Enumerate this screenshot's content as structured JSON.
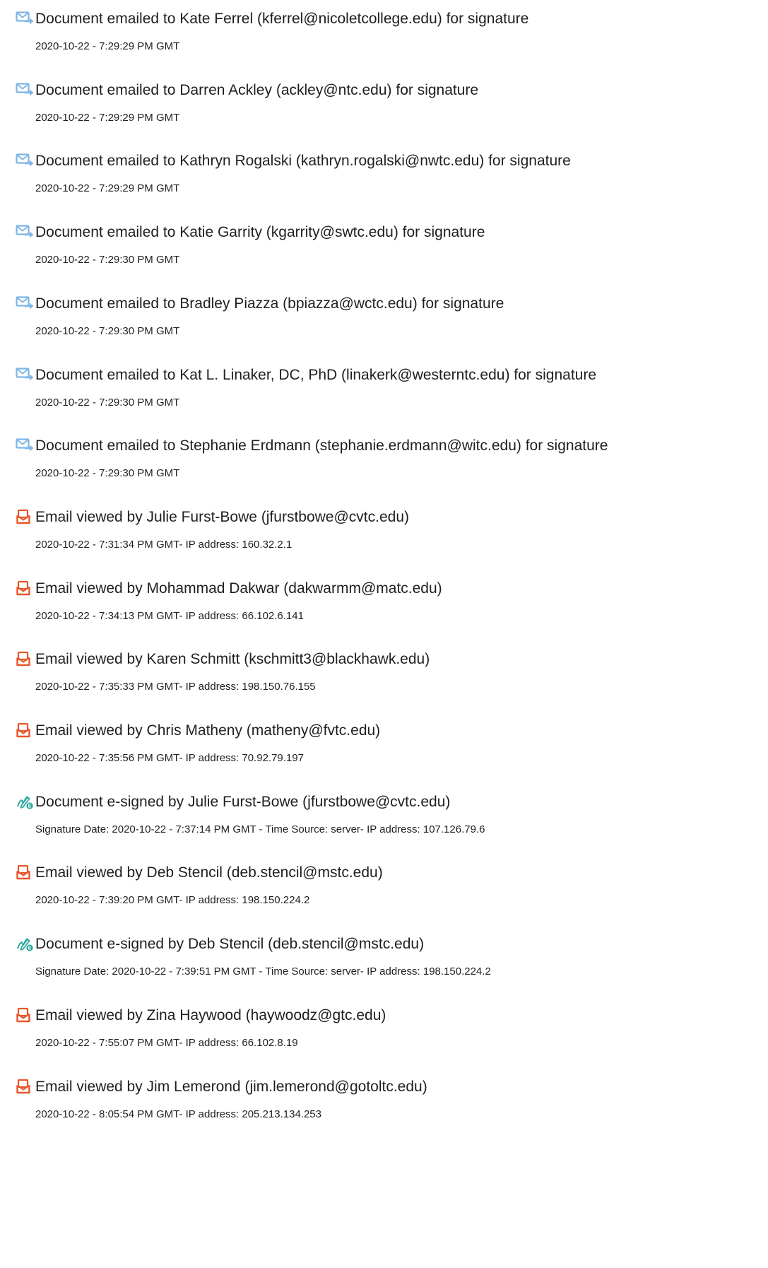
{
  "colors": {
    "emailed_icon": "#7fb6e6",
    "viewed_icon": "#e8562a",
    "signed_icon": "#2aa89a"
  },
  "entries": [
    {
      "icon": "email-sent-icon",
      "title": "Document emailed to Kate Ferrel (kferrel@nicoletcollege.edu) for signature",
      "meta": "2020-10-22 - 7:29:29 PM GMT"
    },
    {
      "icon": "email-sent-icon",
      "title": "Document emailed to Darren Ackley (ackley@ntc.edu) for signature",
      "meta": "2020-10-22 - 7:29:29 PM GMT"
    },
    {
      "icon": "email-sent-icon",
      "title": "Document emailed to Kathryn Rogalski (kathryn.rogalski@nwtc.edu) for signature",
      "meta": "2020-10-22 - 7:29:29 PM GMT"
    },
    {
      "icon": "email-sent-icon",
      "title": "Document emailed to Katie Garrity (kgarrity@swtc.edu) for signature",
      "meta": "2020-10-22 - 7:29:30 PM GMT"
    },
    {
      "icon": "email-sent-icon",
      "title": "Document emailed to Bradley Piazza (bpiazza@wctc.edu) for signature",
      "meta": "2020-10-22 - 7:29:30 PM GMT"
    },
    {
      "icon": "email-sent-icon",
      "title": "Document emailed to Kat L. Linaker, DC, PhD (linakerk@westerntc.edu) for signature",
      "meta": "2020-10-22 - 7:29:30 PM GMT"
    },
    {
      "icon": "email-sent-icon",
      "title": "Document emailed to Stephanie Erdmann (stephanie.erdmann@witc.edu) for signature",
      "meta": "2020-10-22 - 7:29:30 PM GMT"
    },
    {
      "icon": "email-viewed-icon",
      "title": "Email viewed by Julie Furst-Bowe (jfurstbowe@cvtc.edu)",
      "meta": "2020-10-22 - 7:31:34 PM GMT- IP address: 160.32.2.1"
    },
    {
      "icon": "email-viewed-icon",
      "title": "Email viewed by Mohammad Dakwar (dakwarmm@matc.edu)",
      "meta": "2020-10-22 - 7:34:13 PM GMT- IP address: 66.102.6.141"
    },
    {
      "icon": "email-viewed-icon",
      "title": "Email viewed by Karen Schmitt (kschmitt3@blackhawk.edu)",
      "meta": "2020-10-22 - 7:35:33 PM GMT- IP address: 198.150.76.155"
    },
    {
      "icon": "email-viewed-icon",
      "title": "Email viewed by Chris Matheny (matheny@fvtc.edu)",
      "meta": "2020-10-22 - 7:35:56 PM GMT- IP address: 70.92.79.197"
    },
    {
      "icon": "e-sign-icon",
      "title": "Document e-signed by Julie Furst-Bowe (jfurstbowe@cvtc.edu)",
      "meta": "Signature Date: 2020-10-22 - 7:37:14 PM GMT - Time Source: server- IP address: 107.126.79.6"
    },
    {
      "icon": "email-viewed-icon",
      "title": "Email viewed by Deb Stencil (deb.stencil@mstc.edu)",
      "meta": "2020-10-22 - 7:39:20 PM GMT- IP address: 198.150.224.2"
    },
    {
      "icon": "e-sign-icon",
      "title": "Document e-signed by Deb Stencil (deb.stencil@mstc.edu)",
      "meta": "Signature Date: 2020-10-22 - 7:39:51 PM GMT - Time Source: server- IP address: 198.150.224.2"
    },
    {
      "icon": "email-viewed-icon",
      "title": "Email viewed by Zina Haywood (haywoodz@gtc.edu)",
      "meta": "2020-10-22 - 7:55:07 PM GMT- IP address: 66.102.8.19"
    },
    {
      "icon": "email-viewed-icon",
      "title": "Email viewed by Jim Lemerond (jim.lemerond@gotoltc.edu)",
      "meta": "2020-10-22 - 8:05:54 PM GMT- IP address: 205.213.134.253"
    }
  ]
}
